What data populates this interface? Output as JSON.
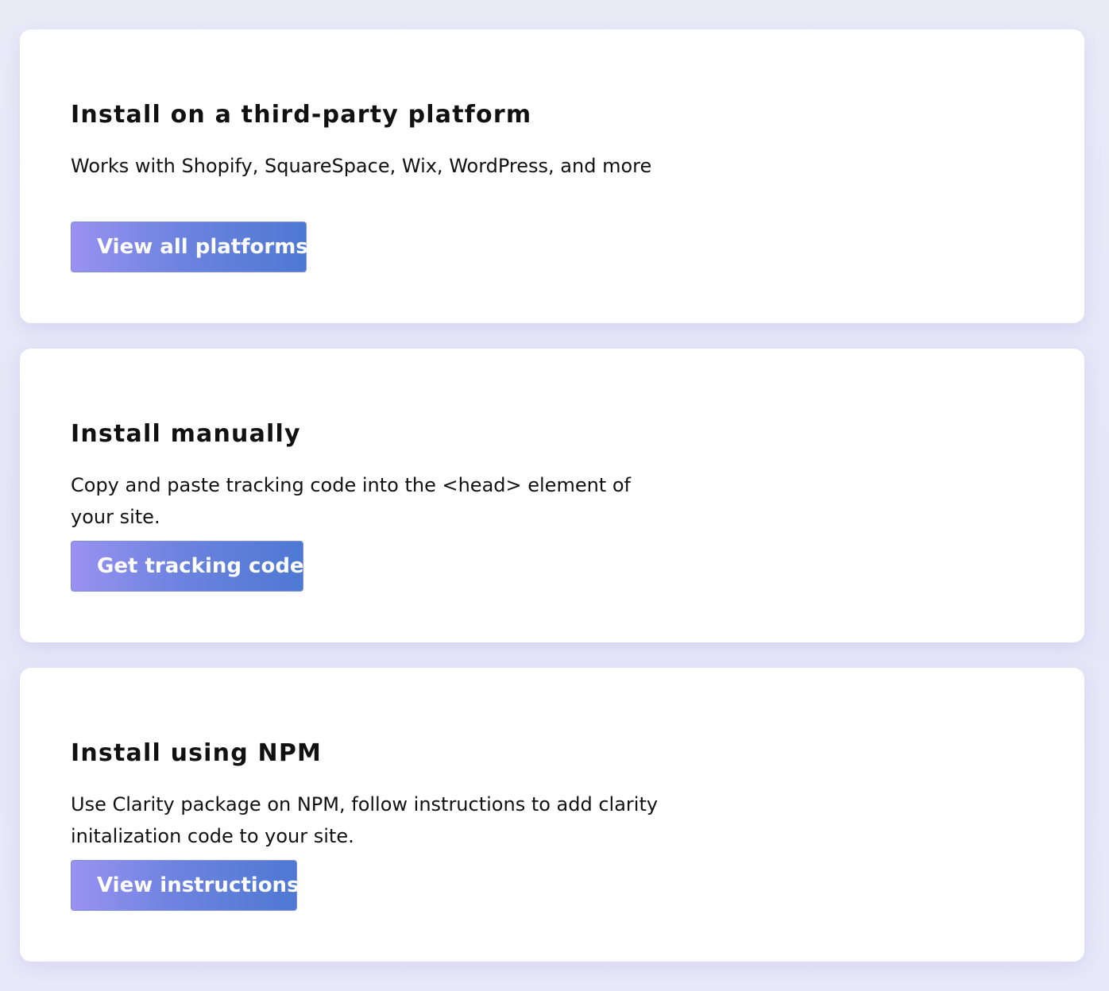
{
  "cards": [
    {
      "title": "Install on a third-party platform",
      "description": "Works with Shopify, SquareSpace, Wix, WordPress, and more",
      "button_label": "View all platforms"
    },
    {
      "title": "Install manually",
      "description": "Copy and paste tracking code into the <head> element of your site.",
      "button_label": "Get tracking code"
    },
    {
      "title": "Install using NPM",
      "description": "Use Clarity package on NPM, follow instructions to add clarity initalization code to your site.",
      "button_label": "View instructions"
    }
  ],
  "colors": {
    "button_gradient_start": "#9a92f2",
    "button_gradient_end": "#4d79d2",
    "card_background": "#ffffff",
    "page_background": "#e8e9f7"
  }
}
